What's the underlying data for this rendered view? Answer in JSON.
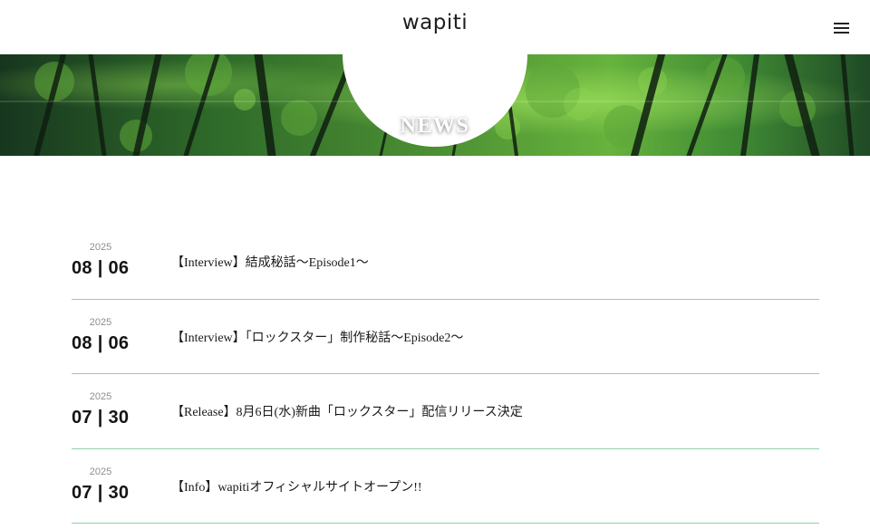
{
  "header": {
    "logo": "wapiti",
    "menu_icon": "hamburger-menu-icon"
  },
  "hero": {
    "title": "NEWS",
    "image": "forest-canopy-image"
  },
  "colors": {
    "divider": "#8fd1a6",
    "date_text": "#141414",
    "year_text": "#8e8e8e"
  },
  "news": [
    {
      "year": "2025",
      "date": "08 | 06",
      "title": "【Interview】結成秘話〜Episode1〜"
    },
    {
      "year": "2025",
      "date": "08 | 06",
      "title": "【Interview】「ロックスター」制作秘話〜Episode2〜"
    },
    {
      "year": "2025",
      "date": "07 | 30",
      "title": "【Release】8月6日(水)新曲「ロックスター」配信リリース決定"
    },
    {
      "year": "2025",
      "date": "07 | 30",
      "title": "【Info】wapitiオフィシャルサイトオープン!!"
    }
  ]
}
